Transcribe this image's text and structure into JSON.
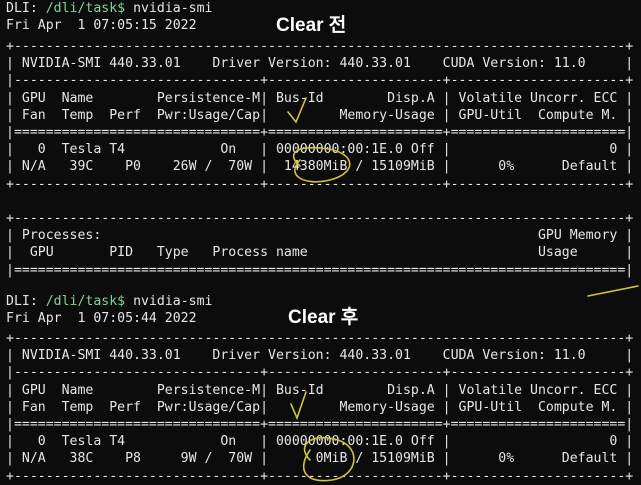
{
  "annotations": {
    "before": "Clear 전",
    "after": "Clear 후"
  },
  "session1": {
    "prompt_host": "DLI:",
    "prompt_dir": "/dli/task$",
    "command": "nvidia-smi",
    "date": "Fri Apr  1 07:05:15 2022",
    "rows": [
      "+-----------------------------------------------------------------------------+",
      "| NVIDIA-SMI 440.33.01    Driver Version: 440.33.01    CUDA Version: 11.0     |",
      "|-------------------------------+----------------------+----------------------+",
      "| GPU  Name        Persistence-M| Bus-Id        Disp.A | Volatile Uncorr. ECC |",
      "| Fan  Temp  Perf  Pwr:Usage/Cap|         Memory-Usage | GPU-Util  Compute M. |",
      "|===============================+======================+======================|",
      "|   0  Tesla T4            On   | 00000000:00:1E.0 Off |                    0 |",
      "| N/A   39C    P0    26W /  70W |  14380MiB / 15109MiB |      0%      Default |",
      "+-------------------------------+----------------------+----------------------+",
      "",
      "+-----------------------------------------------------------------------------+",
      "| Processes:                                                       GPU Memory |",
      "|  GPU       PID   Type   Process name                             Usage      |",
      "|=============================================================================|"
    ]
  },
  "session2": {
    "prompt_host": "DLI:",
    "prompt_dir": "/dli/task$",
    "command": "nvidia-smi",
    "date": "Fri Apr  1 07:05:44 2022",
    "rows": [
      "+-----------------------------------------------------------------------------+",
      "| NVIDIA-SMI 440.33.01    Driver Version: 440.33.01    CUDA Version: 11.0     |",
      "|-------------------------------+----------------------+----------------------+",
      "| GPU  Name        Persistence-M| Bus-Id        Disp.A | Volatile Uncorr. ECC |",
      "| Fan  Temp  Perf  Pwr:Usage/Cap|         Memory-Usage | GPU-Util  Compute M. |",
      "|===============================+======================+======================|",
      "|   0  Tesla T4            On   | 00000000:00:1E.0 Off |                    0 |",
      "| N/A   38C    P8     9W /  70W |      0MiB / 15109MiB |      0%      Default |",
      "+-------------------------------+----------------------+----------------------+"
    ]
  },
  "colors": {
    "background": "#0c0c0c",
    "text": "#e6e6e6",
    "prompt_dir": "#7fd88f",
    "ink": "#d4c43a"
  }
}
